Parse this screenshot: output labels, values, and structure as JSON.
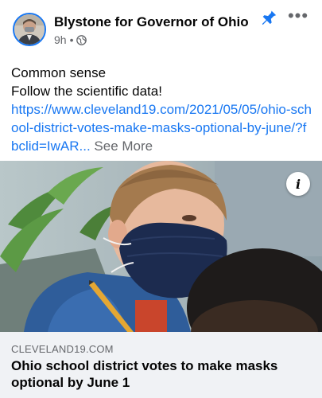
{
  "post": {
    "page_name": "Blystone for Governor of Ohio",
    "time": "9h",
    "dot": "•",
    "text_line1": "Common sense",
    "text_line2": "Follow the scientific data!",
    "link_text": "https://www.cleveland19.com/2021/05/05/ohio-school-district-votes-make-masks-optional-by-june/?fbclid=IwAR...",
    "see_more": "See More"
  },
  "icons": {
    "privacy": "globe-icon",
    "pin": "pin-icon",
    "more": "more-icon",
    "info": "info-icon"
  },
  "labels": {
    "more": "•••",
    "info": "i"
  },
  "link_preview": {
    "domain": "CLEVELAND19.COM",
    "headline": "Ohio school district votes to make masks optional by June 1"
  },
  "colors": {
    "accent": "#1877f2",
    "secondary_text": "#65676b",
    "preview_bg": "#f0f2f5"
  }
}
